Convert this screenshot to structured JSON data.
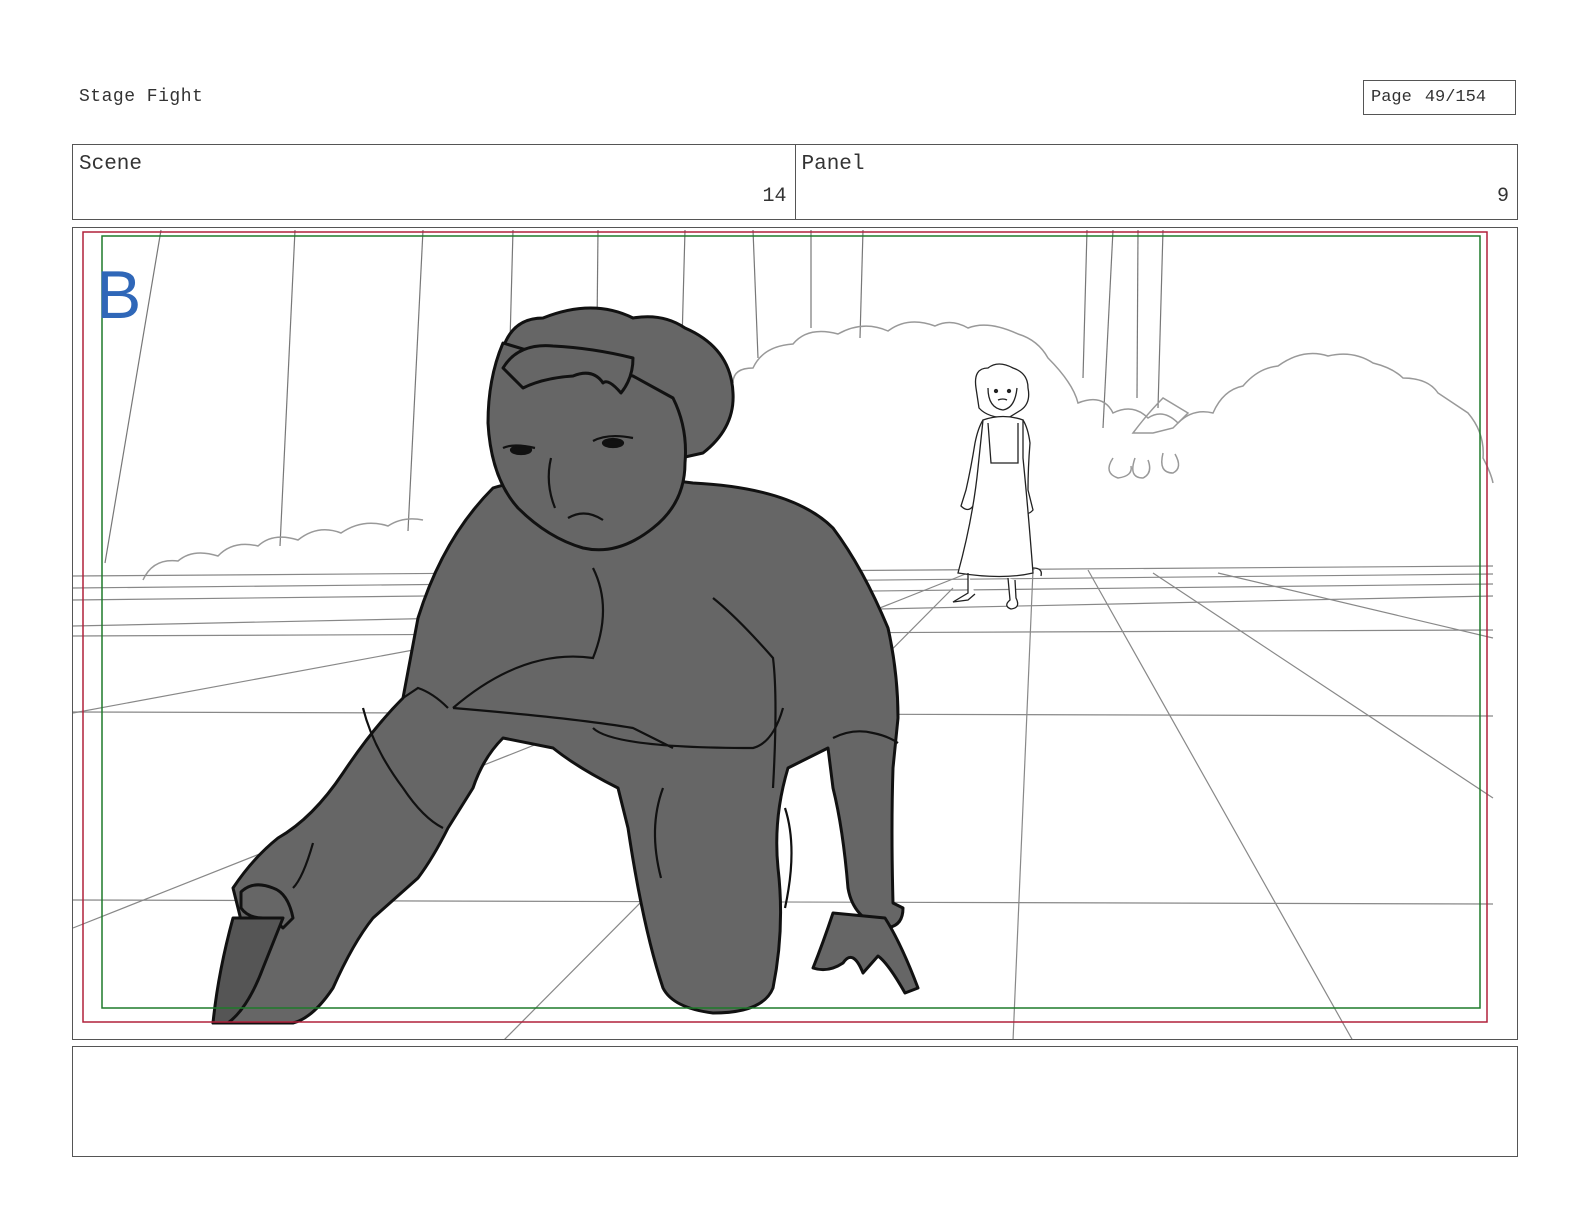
{
  "document": {
    "title": "Stage Fight",
    "page_label": "Page",
    "page_number": "49/154"
  },
  "header": {
    "scene_label": "Scene",
    "scene_value": "14",
    "panel_label": "Panel",
    "panel_value": "9"
  },
  "panel": {
    "shot_letter": "B",
    "colors": {
      "safe_frame_red": "#b0203a",
      "action_safe_green": "#1e7a2a",
      "shot_letter_blue": "#2f67b8",
      "figure_fill": "#666666",
      "pencil_line": "#888888"
    }
  },
  "notes": {
    "text": ""
  }
}
